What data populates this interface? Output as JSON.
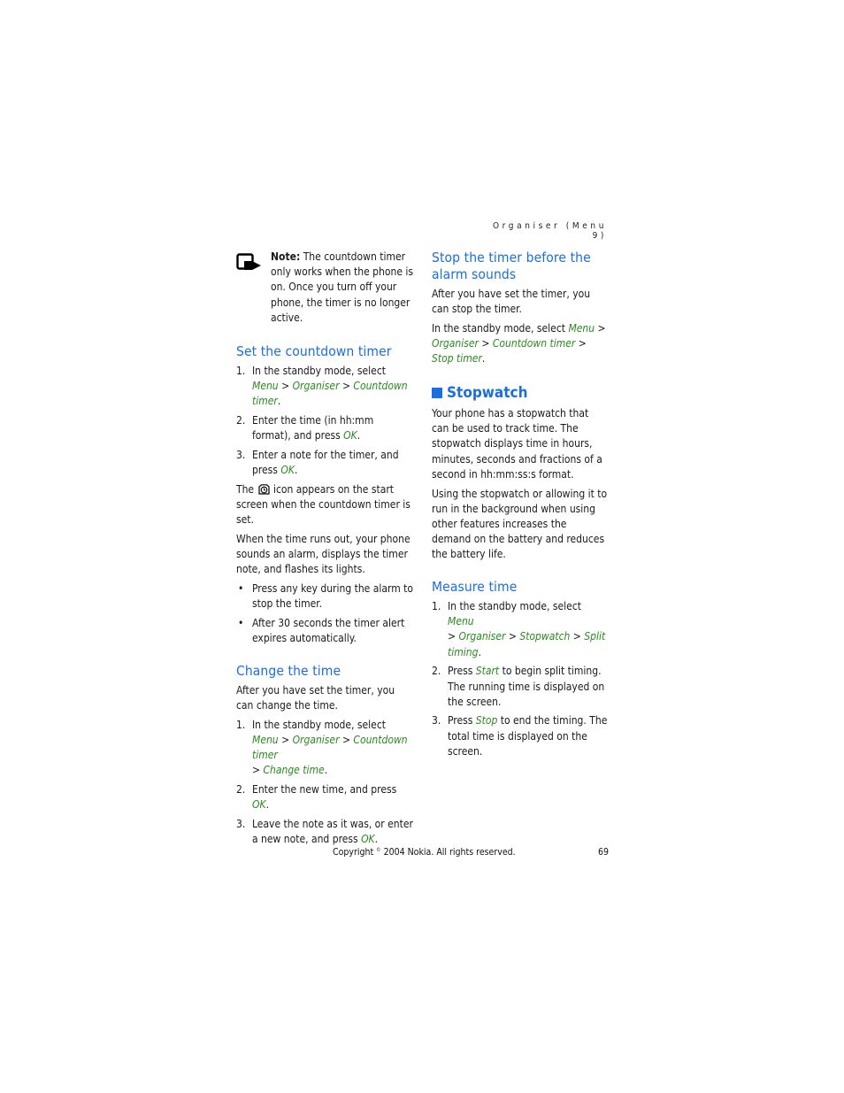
{
  "running_head": "Organiser (Menu 9)",
  "left_column": {
    "note": {
      "icon": "note-hand-icon",
      "label": "Note:",
      "text": " The countdown timer only works when the phone is on. Once you turn off your phone, the timer is no longer active."
    },
    "set_timer": {
      "heading": "Set the countdown timer",
      "steps": [
        {
          "num": "1.",
          "parts": [
            "In the standby mode, select ",
            "Menu",
            " > ",
            "Organiser",
            " > ",
            "Countdown timer",
            "."
          ]
        },
        {
          "num": "2.",
          "parts": [
            "Enter the time (in hh:mm format), and press ",
            "OK",
            "."
          ]
        },
        {
          "num": "3.",
          "parts": [
            "Enter a note for the timer, and press ",
            "OK",
            "."
          ]
        }
      ],
      "icon_para_before": "The ",
      "icon_para_icon": "timer-clock-icon",
      "icon_para_after": " icon appears on the start screen when the countdown timer is set.",
      "runs_out_para": "When the time runs out, your phone sounds an alarm, displays the timer note, and flashes its lights.",
      "bullets": [
        "Press any key during the alarm to stop the timer.",
        "After 30 seconds the timer alert expires automatically."
      ]
    },
    "change_time": {
      "heading": "Change the time",
      "intro": "After you have set the timer, you can change the time.",
      "steps": [
        {
          "num": "1.",
          "parts": [
            "In the standby mode, select ",
            "Menu",
            " > ",
            "Organiser",
            " > ",
            "Countdown timer",
            " > ",
            "Change time",
            "."
          ]
        },
        {
          "num": "2.",
          "parts": [
            "Enter the new time, and press ",
            "OK",
            "."
          ]
        },
        {
          "num": "3.",
          "parts": [
            "Leave the note as it was, or enter a new note, and press ",
            "OK",
            "."
          ]
        }
      ]
    }
  },
  "right_column": {
    "stop_timer": {
      "heading": "Stop the timer before the alarm sounds",
      "intro": "After you have set the timer, you can stop the timer.",
      "parts": [
        "In the standby mode, select ",
        "Menu",
        " > ",
        "Organiser",
        " > ",
        "Countdown timer",
        " > ",
        "Stop timer",
        "."
      ]
    },
    "stopwatch": {
      "heading": "Stopwatch",
      "para1": "Your phone has a stopwatch that can be used to track time. The stopwatch displays time in hours, minutes, seconds and fractions of a second in hh:mm:ss:s format.",
      "para2": "Using the stopwatch or allowing it to run in the background when using other features increases the demand on the battery and reduces the battery life."
    },
    "measure_time": {
      "heading": "Measure time",
      "steps": [
        {
          "num": "1.",
          "parts": [
            "In the standby mode, select ",
            "Menu",
            " > ",
            "Organiser",
            " > ",
            "Stopwatch",
            " > ",
            "Split timing",
            "."
          ]
        },
        {
          "num": "2.",
          "parts": [
            "Press ",
            "Start",
            " to begin split timing. The running time is displayed on the screen."
          ]
        },
        {
          "num": "3.",
          "parts": [
            "Press ",
            "Stop",
            " to end the timing. The total time is displayed on the screen."
          ]
        }
      ]
    }
  },
  "footer": {
    "copyright_before": "Copyright ",
    "copyright_symbol": "©",
    "copyright_after": " 2004 Nokia. All rights reserved.",
    "page_number": "69"
  },
  "colors": {
    "heading_blue": "#1a6fe0",
    "menu_green": "#2a8a1f"
  }
}
